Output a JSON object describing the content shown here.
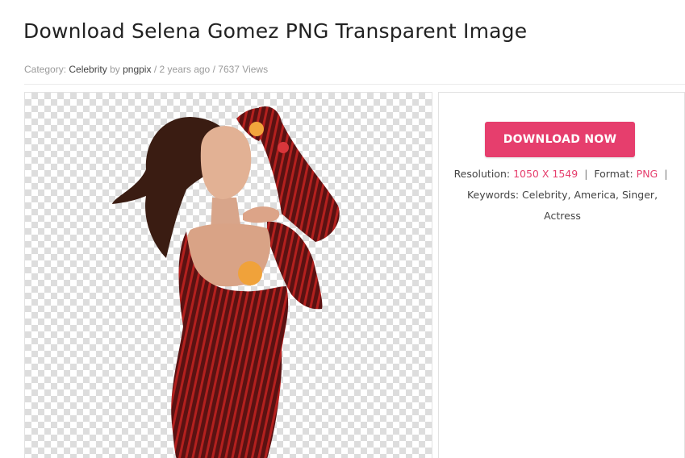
{
  "page": {
    "title": "Download Selena Gomez PNG Transparent Image"
  },
  "meta": {
    "category_label": "Category:",
    "category": "Celebrity",
    "by_label": "by",
    "author": "pngpix",
    "separator": "/",
    "age": "2 years ago",
    "views": "7637 Views"
  },
  "preview": {
    "image_subject": "Selena Gomez in red striped dress, transparent background"
  },
  "download": {
    "button_label": "DOWNLOAD NOW"
  },
  "details": {
    "resolution_label": "Resolution:",
    "resolution_value": "1050 X 1549",
    "divider": "|",
    "format_label": "Format:",
    "format_value": "PNG",
    "keywords_label": "Keywords:",
    "keywords": [
      "Celebrity",
      "America",
      "Singer",
      "Actress"
    ]
  },
  "colors": {
    "accent": "#e63e6d",
    "text": "#222222",
    "muted": "#9a9a9a"
  }
}
